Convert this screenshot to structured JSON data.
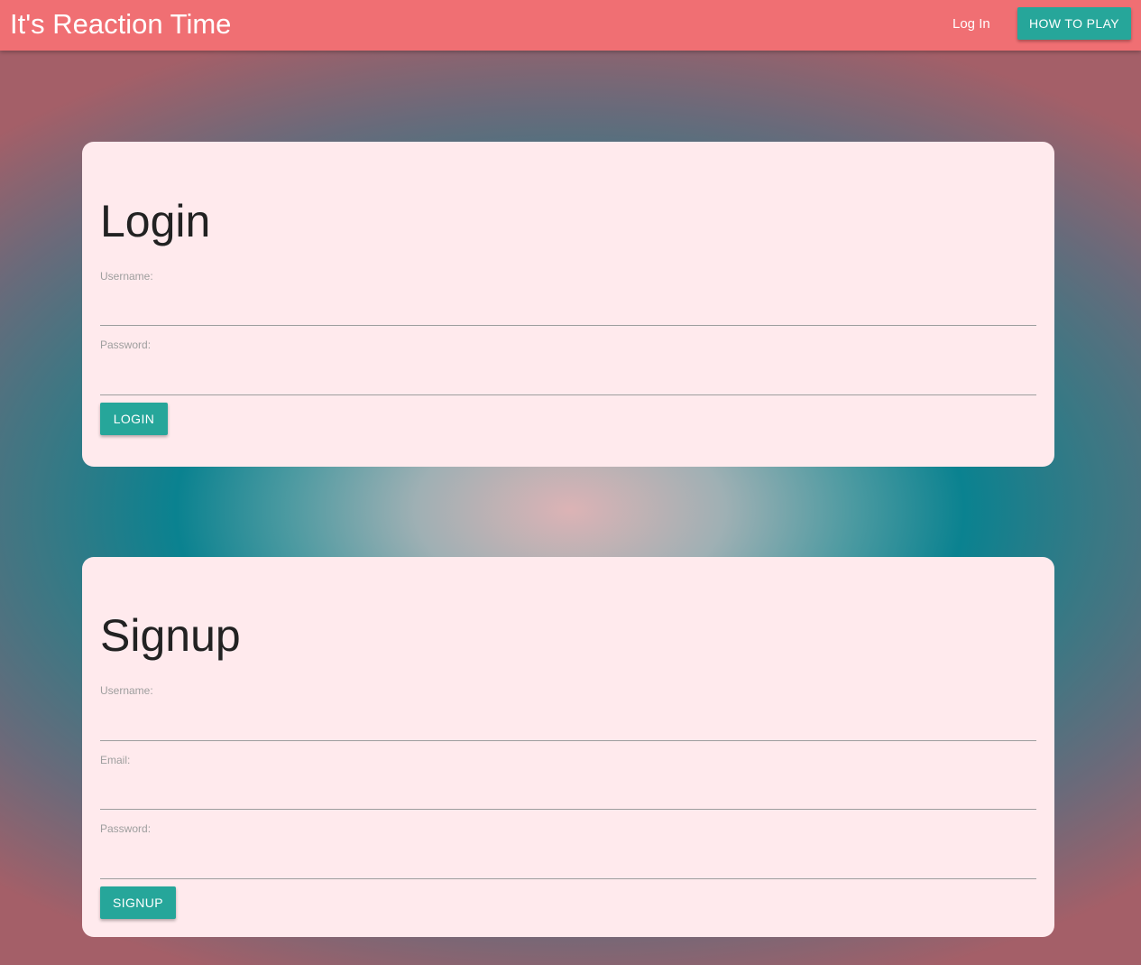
{
  "header": {
    "title": "It's Reaction Time",
    "login_link": "Log In",
    "how_to_play_label": "HOW TO PLAY"
  },
  "login": {
    "title": "Login",
    "username_label": "Username:",
    "username_value": "",
    "password_label": "Password:",
    "password_value": "",
    "submit_label": "LOGIN"
  },
  "signup": {
    "title": "Signup",
    "username_label": "Username:",
    "username_value": "",
    "email_label": "Email:",
    "email_value": "",
    "password_label": "Password:",
    "password_value": "",
    "submit_label": "SIGNUP"
  },
  "colors": {
    "navbar": "#f06f73",
    "accent_button": "#26a69a",
    "card_background": "#ffeaed"
  }
}
